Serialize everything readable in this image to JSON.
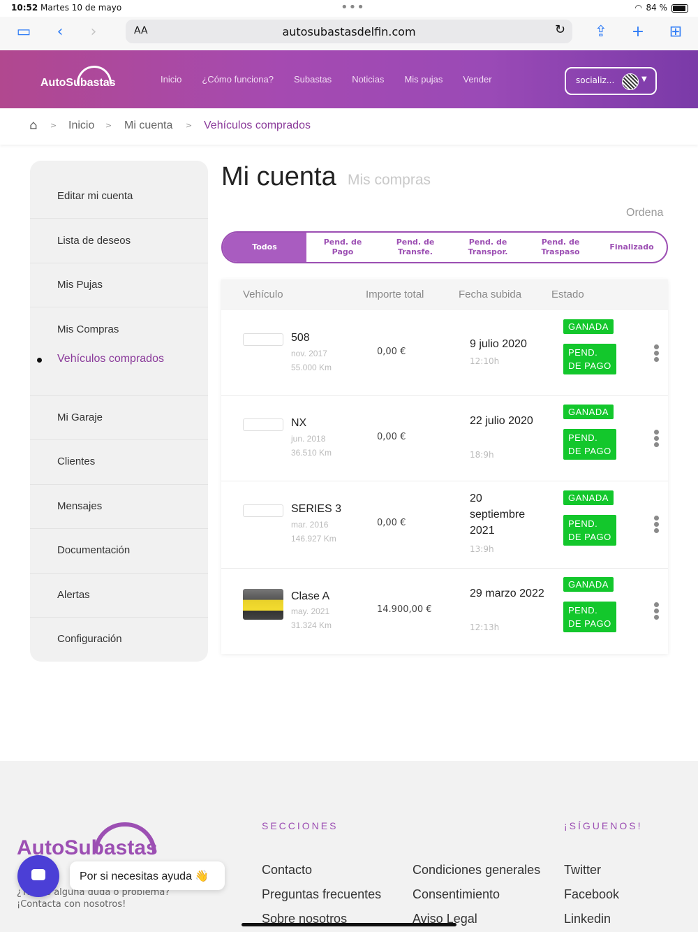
{
  "status": {
    "time": "10:52",
    "date": "Martes 10 de mayo",
    "battery": "84 %"
  },
  "browser": {
    "aa": "AA",
    "url": "autosubastasdelfin.com"
  },
  "header": {
    "logo": "AutoSubastas",
    "nav": [
      "Inicio",
      "¿Cómo funciona?",
      "Subastas",
      "Noticias",
      "Mis pujas",
      "Vender"
    ],
    "user": "socializ..."
  },
  "breadcrumb": [
    "Inicio",
    "Mi cuenta",
    "Vehículos comprados"
  ],
  "sidebar": {
    "items": [
      "Editar mi cuenta",
      "Lista de deseos",
      "Mis Pujas",
      "Mis Compras",
      "Mi Garaje",
      "Clientes",
      "Mensajes",
      "Documentación",
      "Alertas",
      "Configuración"
    ],
    "sub_active": "Vehículos comprados"
  },
  "main": {
    "title": "Mi cuenta",
    "subtitle": "Mis compras",
    "order": "Ordena",
    "filters": [
      {
        "l1": "Todos",
        "l2": ""
      },
      {
        "l1": "Pend. de",
        "l2": "Pago"
      },
      {
        "l1": "Pend. de",
        "l2": "Transfe."
      },
      {
        "l1": "Pend. de",
        "l2": "Transpor."
      },
      {
        "l1": "Pend. de",
        "l2": "Traspaso"
      },
      {
        "l1": "Finalizado",
        "l2": ""
      }
    ],
    "columns": [
      "Vehículo",
      "Importe total",
      "Fecha subida",
      "Estado"
    ],
    "rows": [
      {
        "name": "508",
        "date": "nov. 2017",
        "km": "55.000 Km",
        "amount": "0,00 €",
        "fecha": "9 julio 2020",
        "hora": "12:10h",
        "estado1": "GANADA",
        "estado2": "PEND. DE PAGO"
      },
      {
        "name": "NX",
        "date": "jun. 2018",
        "km": "36.510 Km",
        "amount": "0,00 €",
        "fecha": "22 julio 2020",
        "hora": "18:9h",
        "estado1": "GANADA",
        "estado2": "PEND. DE PAGO"
      },
      {
        "name": "SERIES 3",
        "date": "mar. 2016",
        "km": "146.927 Km",
        "amount": "0,00 €",
        "fecha": "20 septiembre 2021",
        "hora": "13:9h",
        "estado1": "GANADA",
        "estado2": "PEND. DE PAGO"
      },
      {
        "name": "Clase A",
        "date": "may. 2021",
        "km": "31.324 Km",
        "amount": "14.900,00 €",
        "fecha": "29 marzo 2022",
        "hora": "12:13h",
        "estado1": "GANADA",
        "estado2": "PEND. DE PAGO"
      }
    ]
  },
  "footer": {
    "logo": "AutoSubastas",
    "help1": "¿Tienes alguna duda o problema?",
    "help2": "¡Contacta con nosotros!",
    "secciones": "SECCIONES",
    "siguenos": "¡SÍGUENOS!",
    "col1": [
      "Contacto",
      "Preguntas frecuentes",
      "Sobre nosotros"
    ],
    "col2": [
      "Condiciones generales",
      "Consentimiento",
      "Aviso Legal"
    ],
    "social": [
      "Twitter",
      "Facebook",
      "Linkedin"
    ]
  },
  "chat": {
    "tooltip": "Por si necesitas ayuda 👋"
  },
  "colors": {
    "purple": "#9c4fb3",
    "green": "#13c72c",
    "chat": "#4b3fd6"
  }
}
